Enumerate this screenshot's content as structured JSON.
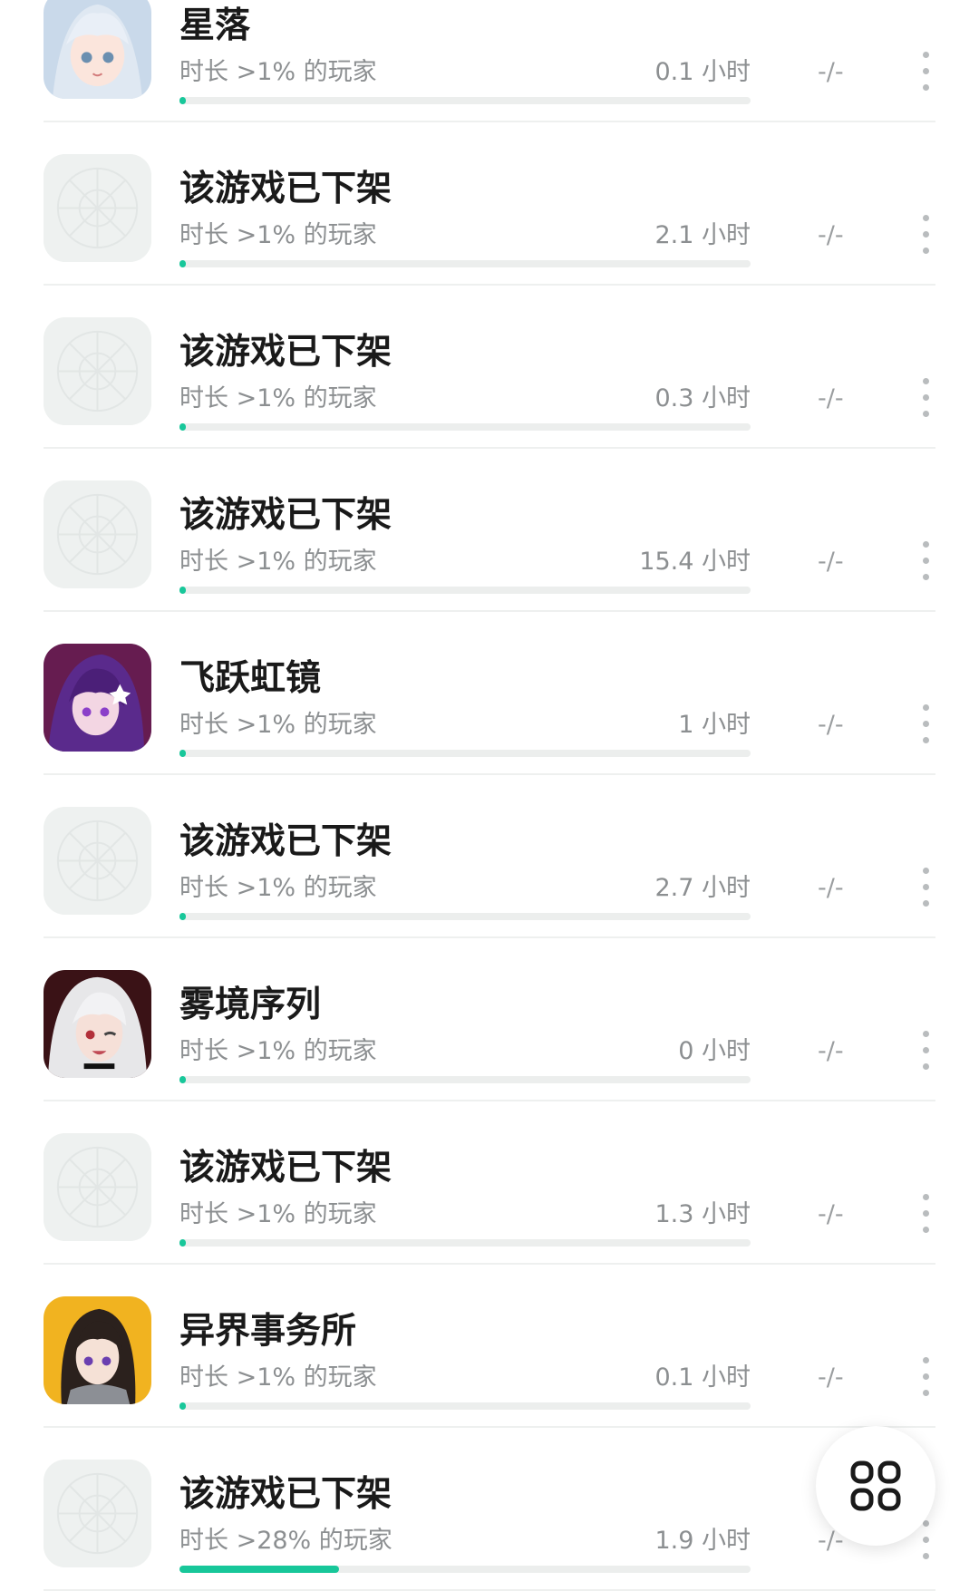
{
  "colors": {
    "accent": "#18c79a",
    "track": "#eceeed",
    "text_muted": "#8c8f91"
  },
  "games": [
    {
      "title": "星落",
      "subtitle": "时长 >1% 的玩家",
      "hours": "0.1 小时",
      "percentile": 0.01,
      "achievements": "-/-",
      "icon": "anime-girl-silver-hair"
    },
    {
      "title": "该游戏已下架",
      "subtitle": "时长 >1% 的玩家",
      "hours": "2.1 小时",
      "percentile": 0.01,
      "achievements": "-/-",
      "icon": "placeholder-icon"
    },
    {
      "title": "该游戏已下架",
      "subtitle": "时长 >1% 的玩家",
      "hours": "0.3 小时",
      "percentile": 0.01,
      "achievements": "-/-",
      "icon": "placeholder-icon"
    },
    {
      "title": "该游戏已下架",
      "subtitle": "时长 >1% 的玩家",
      "hours": "15.4 小时",
      "percentile": 0.01,
      "achievements": "-/-",
      "icon": "placeholder-icon"
    },
    {
      "title": "飞跃虹镜",
      "subtitle": "时长 >1% 的玩家",
      "hours": "1 小时",
      "percentile": 0.01,
      "achievements": "-/-",
      "icon": "anime-girl-purple-hair"
    },
    {
      "title": "该游戏已下架",
      "subtitle": "时长 >1% 的玩家",
      "hours": "2.7 小时",
      "percentile": 0.01,
      "achievements": "-/-",
      "icon": "placeholder-icon"
    },
    {
      "title": "雾境序列",
      "subtitle": "时长 >1% 的玩家",
      "hours": "0 小时",
      "percentile": 0.01,
      "achievements": "-/-",
      "icon": "anime-girl-white-hair"
    },
    {
      "title": "该游戏已下架",
      "subtitle": "时长 >1% 的玩家",
      "hours": "1.3 小时",
      "percentile": 0.01,
      "achievements": "-/-",
      "icon": "placeholder-icon"
    },
    {
      "title": "异界事务所",
      "subtitle": "时长 >1% 的玩家",
      "hours": "0.1 小时",
      "percentile": 0.01,
      "achievements": "-/-",
      "icon": "anime-girl-dark-hair-yellow-bg"
    },
    {
      "title": "该游戏已下架",
      "subtitle": "时长 >28% 的玩家",
      "hours": "1.9 小时",
      "percentile": 0.28,
      "achievements": "-/-",
      "icon": "placeholder-icon"
    }
  ],
  "fab": {
    "icon": "grid-icon"
  }
}
